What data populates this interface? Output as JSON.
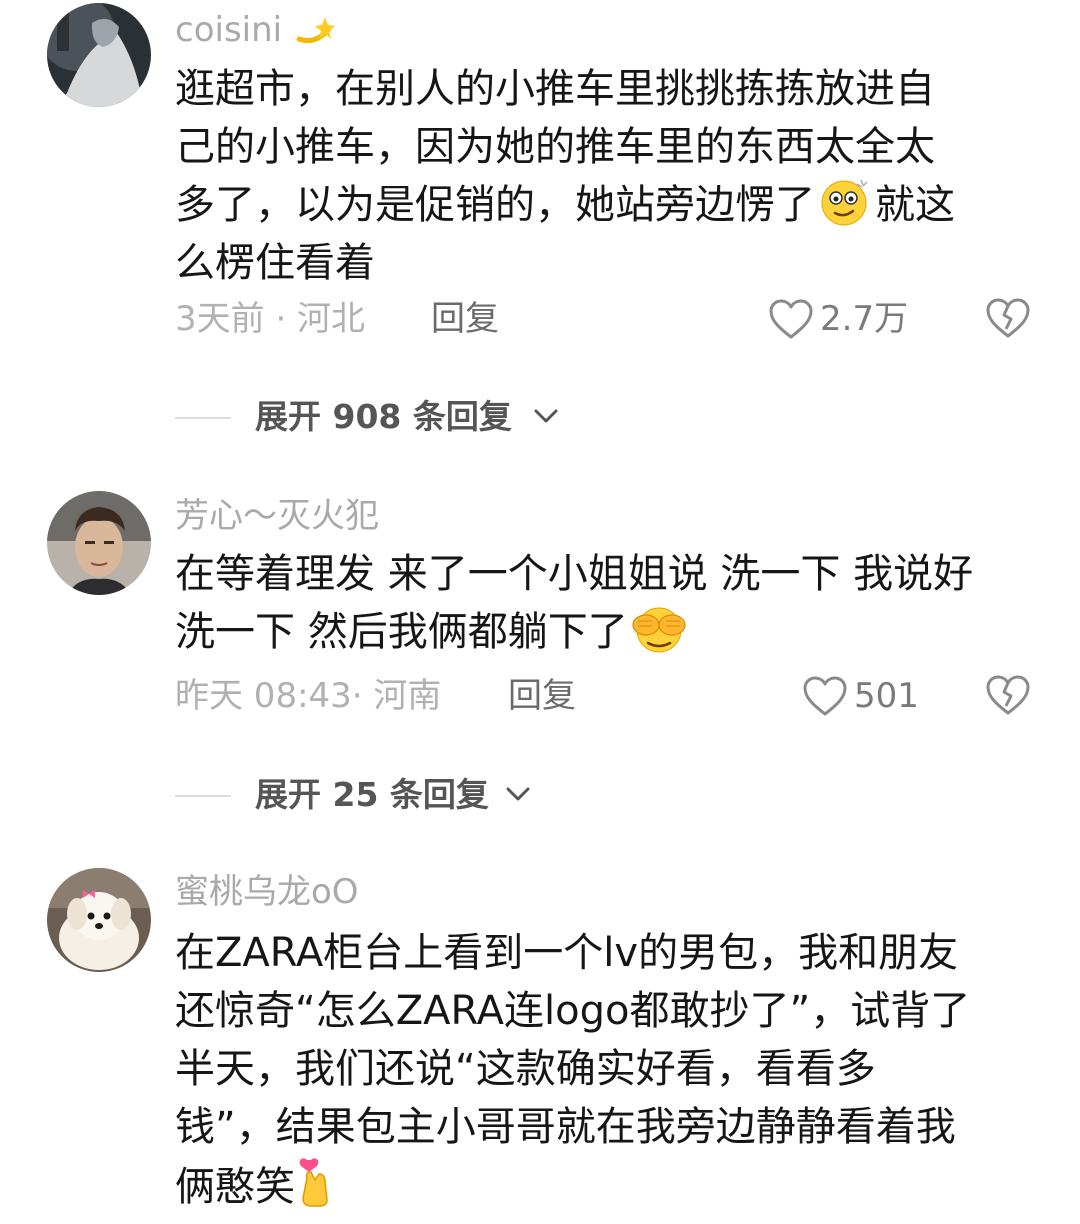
{
  "comments": [
    {
      "username": "coisini",
      "lines": [
        "逛超市，在别人的小推车里挑挑拣拣放进自",
        "己的小推车，因为她的推车里的东西太全太",
        "多了，以为是促销的，她站旁边愣了",
        "就这",
        "么楞住看着"
      ],
      "time_location": "3天前 · 河北",
      "reply_label": "回复",
      "like_count": "2.7万",
      "expand_label": "展开 908 条回复"
    },
    {
      "username": "芳心～灭火犯",
      "lines": [
        "在等着理发 来了一个小姐姐说 洗一下 我说好",
        "洗一下 然后我俩都躺下了"
      ],
      "time_location": "昨天 08:43· 河南",
      "reply_label": "回复",
      "like_count": "501",
      "expand_label": "展开 25 条回复"
    },
    {
      "username": "蜜桃乌龙oO",
      "lines": [
        "在ZARA柜台上看到一个lv的男包，我和朋友",
        "还惊奇“怎么ZARA连logo都敢抄了”，试背了",
        "半天，我们还说“这款确实好看，看看多",
        "钱”，结果包主小哥哥就在我旁边静静看着我",
        "俩憨笑"
      ]
    }
  ],
  "icons": {
    "like": "heart-outline-icon",
    "dislike": "broken-heart-icon",
    "expand": "chevron-down-icon",
    "emoji_1": "dizzy-star-emoji-icon",
    "emoji_2": "dazed-face-emoji-icon",
    "emoji_3": "see-no-evil-face-emoji-icon",
    "emoji_4": "finger-heart-emoji-icon"
  },
  "colors": {
    "text": "#161616",
    "username": "#a9a9a9",
    "meta": "#b1b1b1",
    "reply": "#6b6b6b",
    "expand": "#555555",
    "icon": "#8a8a8a"
  }
}
